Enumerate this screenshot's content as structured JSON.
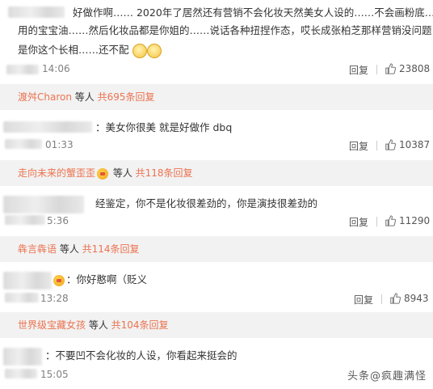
{
  "comments": [
    {
      "line1": "好做作啊…… 2020年了居然还有营销不会化妆天然美女人设的……不会画粉底……",
      "line2": "用的宝宝油……然后化妆品都是你姐的……说话各种扭捏作态，哎长成张柏芝那样营销没问题，可",
      "line3": "是你这个长相……还不配",
      "time": "14:06",
      "reply": "回复",
      "likes": "23808",
      "replybar": {
        "name": "渡舛Charon",
        "suffix": " 等人 ",
        "count": "共695条回复"
      }
    },
    {
      "line1": "美女你很美 就是好做作 dbq",
      "time": "01:33",
      "reply": "回复",
      "likes": "10387",
      "replybar": {
        "name": "走向未来的蟹歪歪",
        "suffix": " 等人 ",
        "count": "共118条回复"
      }
    },
    {
      "line1": "经鉴定，你不是化妆很差劲的，你是演技很差劲的",
      "time": "5:36",
      "reply": "回复",
      "likes": "11290",
      "replybar": {
        "name": "犇言犇语",
        "suffix": " 等人 ",
        "count": "共114条回复"
      }
    },
    {
      "line1": "你好憨啊（贬义",
      "time": "13:28",
      "reply": "回复",
      "likes": "8943",
      "replybar": {
        "name": "世界级宝藏女孩",
        "suffix": " 等人 ",
        "count": "共104条回复"
      }
    },
    {
      "line1": "不要凹不会化妆的人设，你看起来挺会的",
      "time": "15:05",
      "reply": "",
      "likes": ""
    }
  ],
  "watermark": "头条@疯趣满怪",
  "icons": {
    "like": "thumbs-up-icon",
    "emoji": "laughing-face-icon",
    "badge": "vip-badge-icon"
  },
  "colors": {
    "link": "#eb7350",
    "replybar_bg": "#f2f2f2",
    "time": "#808080"
  }
}
